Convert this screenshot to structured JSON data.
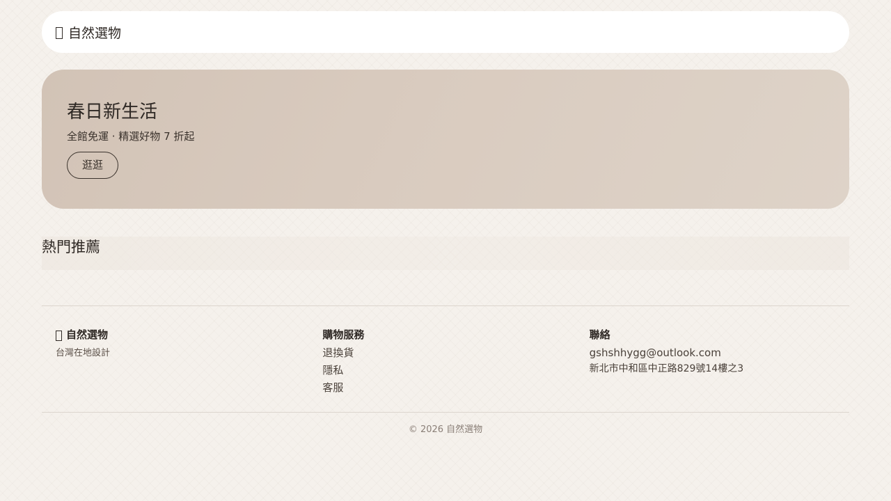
{
  "header": {
    "brand": "自然選物",
    "brand_icon": "box-icon"
  },
  "hero": {
    "title": "春日新生活",
    "subtitle": "全館免運 · 精選好物 7 折起",
    "cta_label": "逛逛"
  },
  "sections": {
    "recommend_title": "熱門推薦"
  },
  "footer": {
    "brand": "自然選物",
    "tagline": "台灣在地設計",
    "service_title": "購物服務",
    "service_links": [
      "退換貨",
      "隱私",
      "客服"
    ],
    "contact_title": "聯絡",
    "email": "gshshhygg@outlook.com",
    "address": "新北市中和區中正路829號14樓之3",
    "copyright": "© 2026 自然選物"
  },
  "colors": {
    "background": "#f5f1ec",
    "hero_start": "#d2c3b6",
    "hero_end": "#ded3c8",
    "text": "#3a322c"
  }
}
